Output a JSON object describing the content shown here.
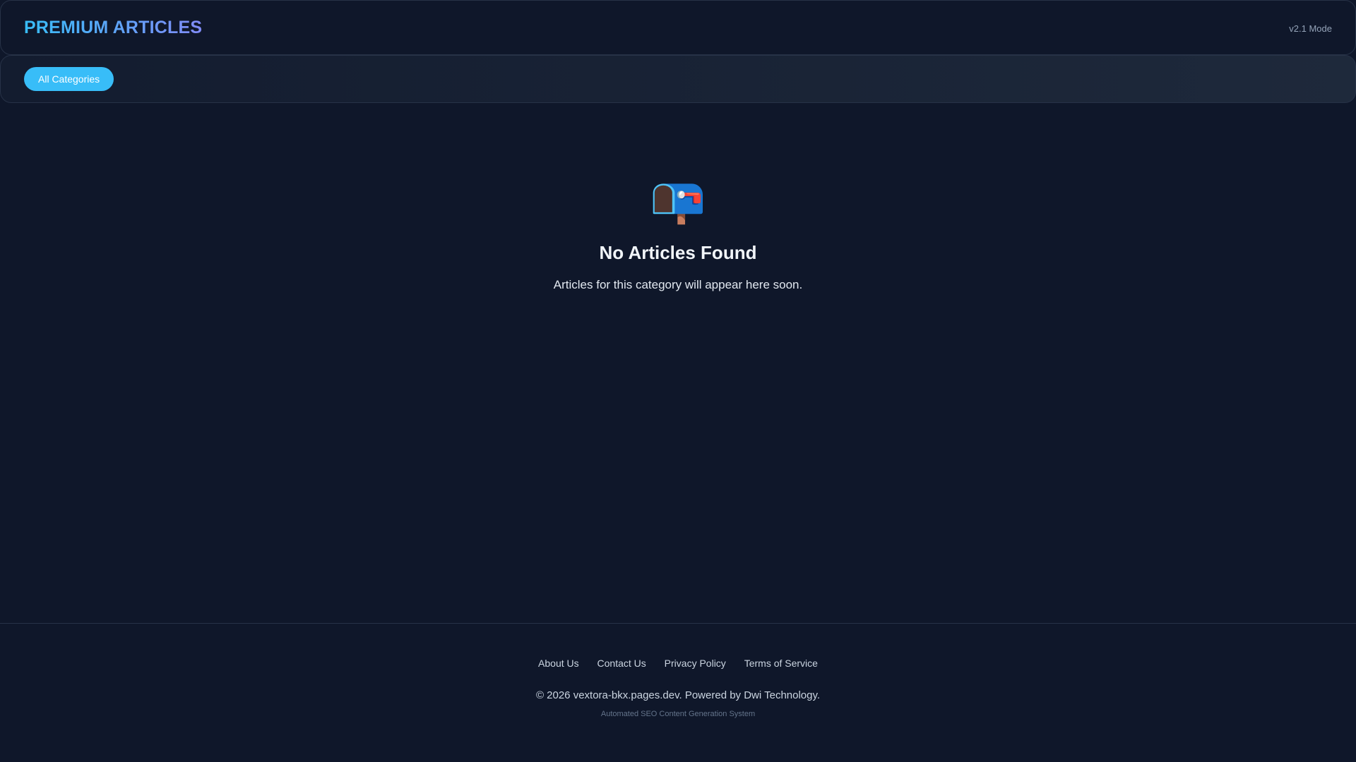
{
  "header": {
    "title": "PREMIUM ARTICLES",
    "version": "v2.1 Mode"
  },
  "nav": {
    "categories": [
      "All Categories"
    ]
  },
  "empty_state": {
    "icon": "mailbox-icon",
    "emoji": "📭",
    "title": "No Articles Found",
    "message": "Articles for this category will appear here soon."
  },
  "footer": {
    "links": [
      "About Us",
      "Contact Us",
      "Privacy Policy",
      "Terms of Service"
    ],
    "copyright": "© 2026 vextora-bkx.pages.dev. Powered by Dwi Technology.",
    "tagline": "Automated SEO Content Generation System"
  },
  "colors": {
    "background": "#0f172a",
    "accent": "#38bdf8"
  }
}
